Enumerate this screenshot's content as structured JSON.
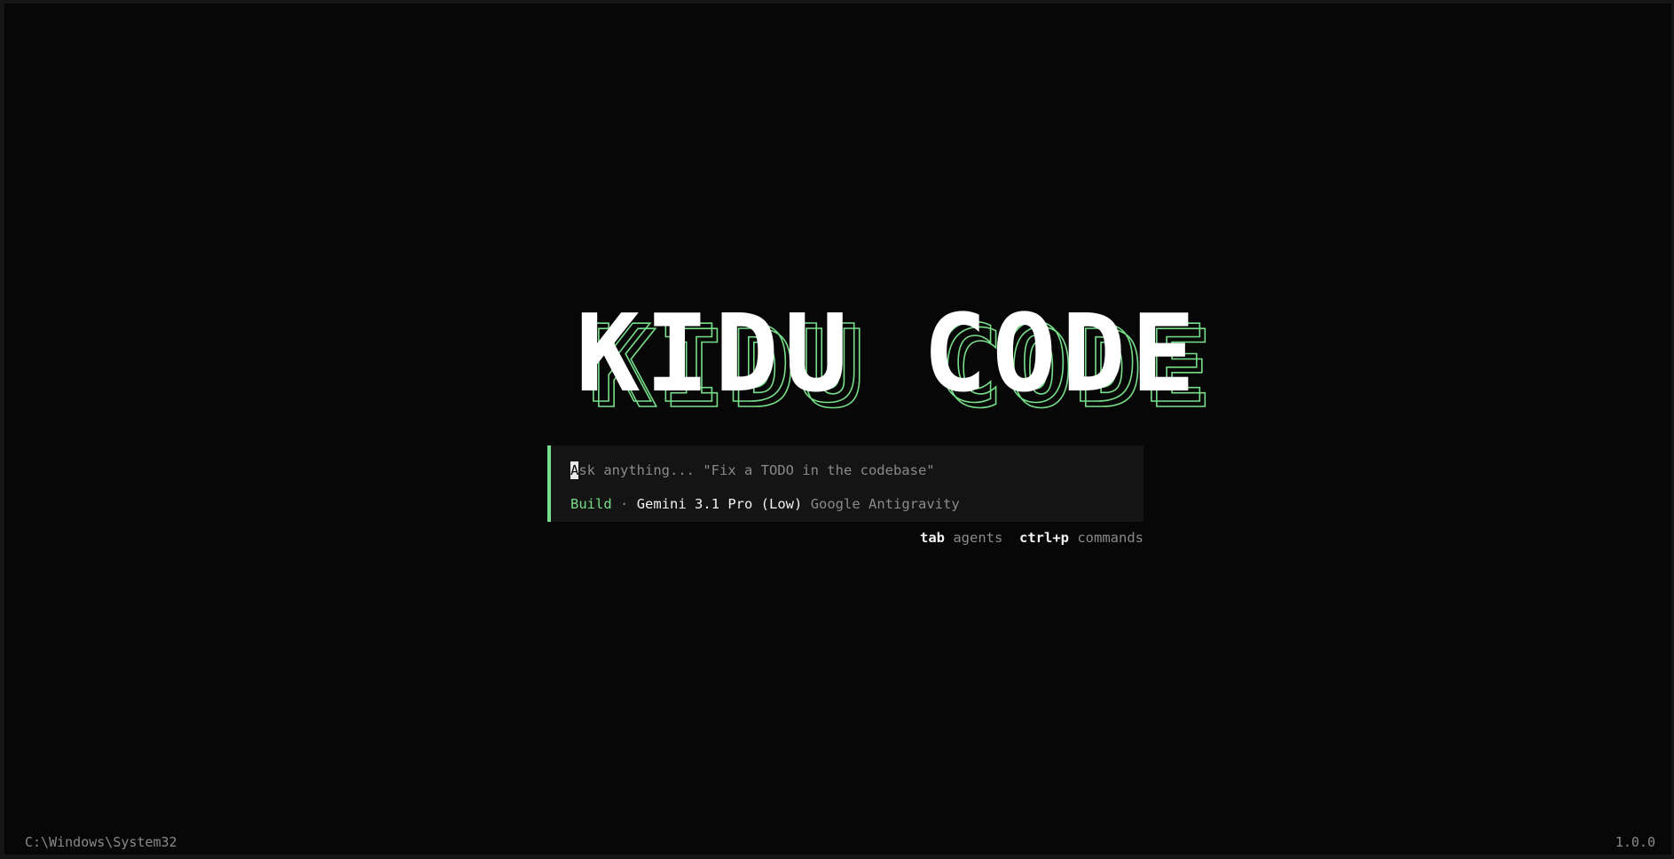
{
  "app": {
    "logo_text": "KIDU CODE",
    "accent_color": "#77dd88",
    "logo_color": "#ffffff"
  },
  "prompt": {
    "cursor_char": "A",
    "placeholder_rest": "sk anything... \"Fix a TODO in the codebase\""
  },
  "status": {
    "mode": "Build",
    "separator": "·",
    "model": "Gemini 3.1 Pro (Low)",
    "provider": "Google Antigravity"
  },
  "hints": [
    {
      "key": "tab",
      "label": "agents"
    },
    {
      "key": "ctrl+p",
      "label": "commands"
    }
  ],
  "footer": {
    "cwd": "C:\\Windows\\System32",
    "version": "1.0.0"
  }
}
